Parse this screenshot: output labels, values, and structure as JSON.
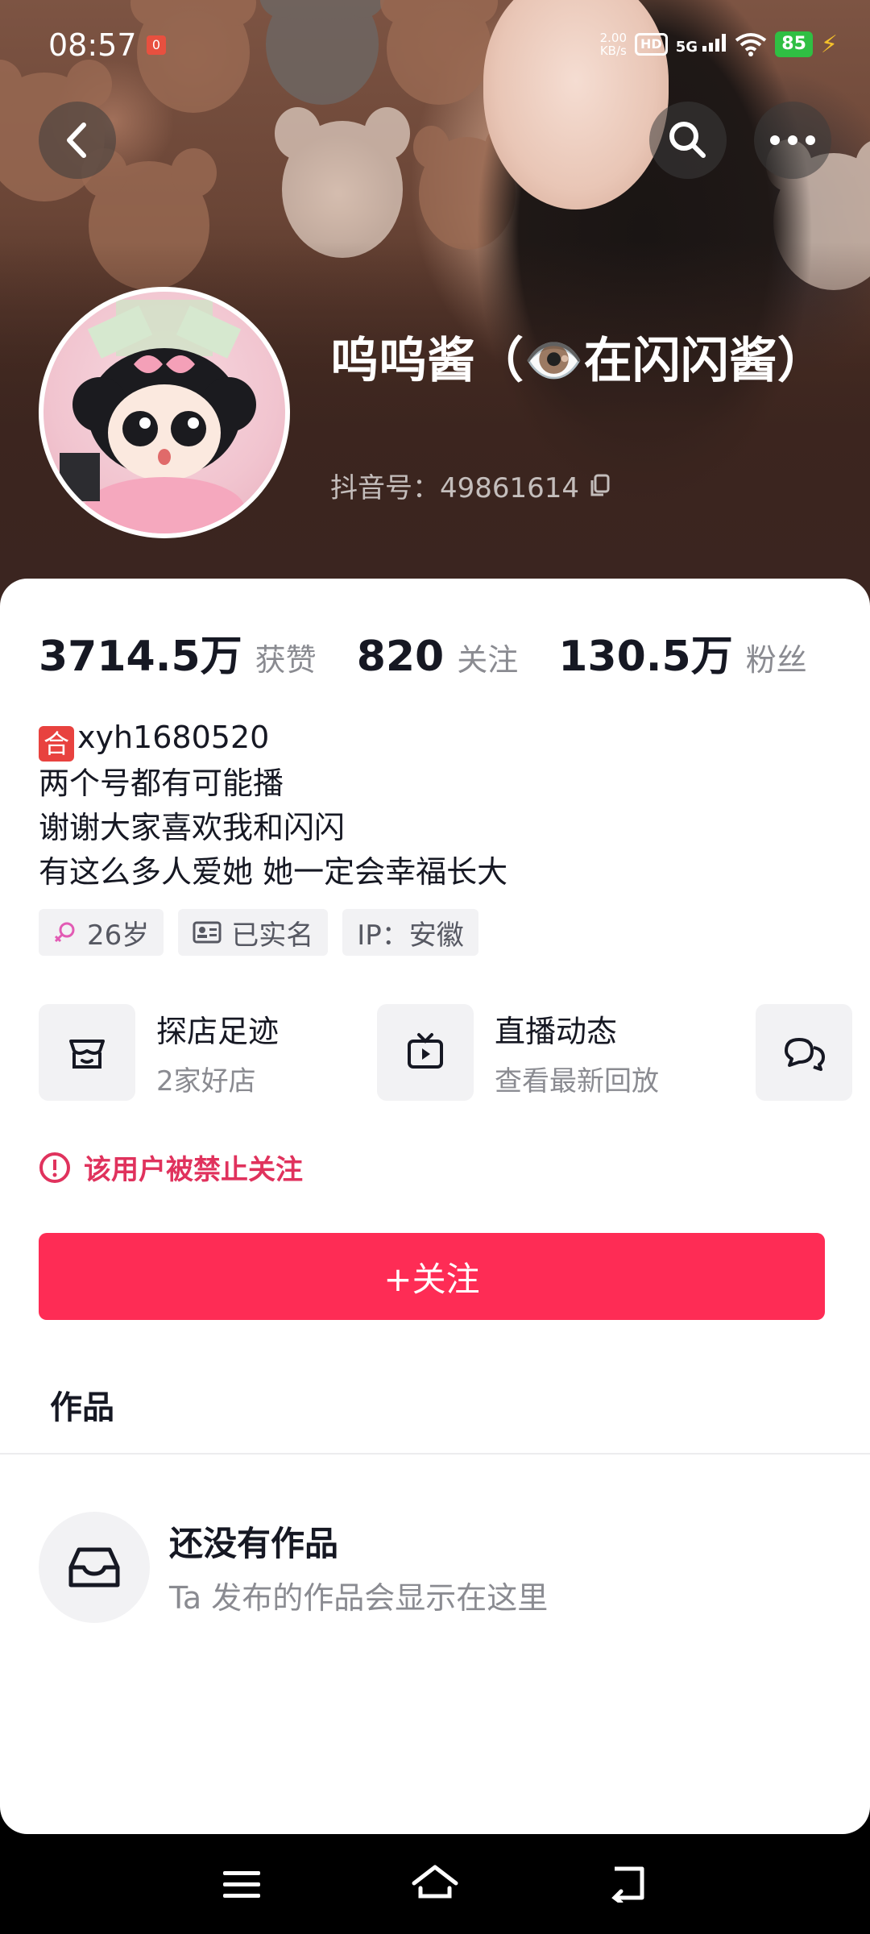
{
  "status_bar": {
    "time": "08:57",
    "notification_badge": "0",
    "net_speed": "2.00",
    "net_speed_unit": "KB/s",
    "hd_label": "HD",
    "network": "5G",
    "battery": "85"
  },
  "profile": {
    "nickname": "呜呜酱（👁️在闪闪酱）",
    "douyin_id_label": "抖音号：",
    "douyin_id": "49861614"
  },
  "stats": [
    {
      "value": "3714.5万",
      "label": "获赞"
    },
    {
      "value": "820",
      "label": "关注"
    },
    {
      "value": "130.5万",
      "label": "粉丝"
    }
  ],
  "bio": {
    "badge": "合",
    "line1": "xyh1680520",
    "line2": "两个号都有可能播",
    "line3": "谢谢大家喜欢我和闪闪",
    "line4": "有这么多人爱她 她一定会幸福长大"
  },
  "tags": {
    "age": "26岁",
    "verified": "已实名",
    "ip": "IP：安徽"
  },
  "services": {
    "shop": {
      "title": "探店足迹",
      "subtitle": "2家好店"
    },
    "live": {
      "title": "直播动态",
      "subtitle": "查看最新回放"
    }
  },
  "blocked_notice": "该用户被禁止关注",
  "follow_button": "+关注",
  "works_tab": "作品",
  "empty_state": {
    "title": "还没有作品",
    "subtitle": "Ta 发布的作品会显示在这里"
  },
  "colors": {
    "accent": "#fe2c55",
    "warning": "#e0325d",
    "text": "#161823",
    "muted": "#8a8b91"
  }
}
